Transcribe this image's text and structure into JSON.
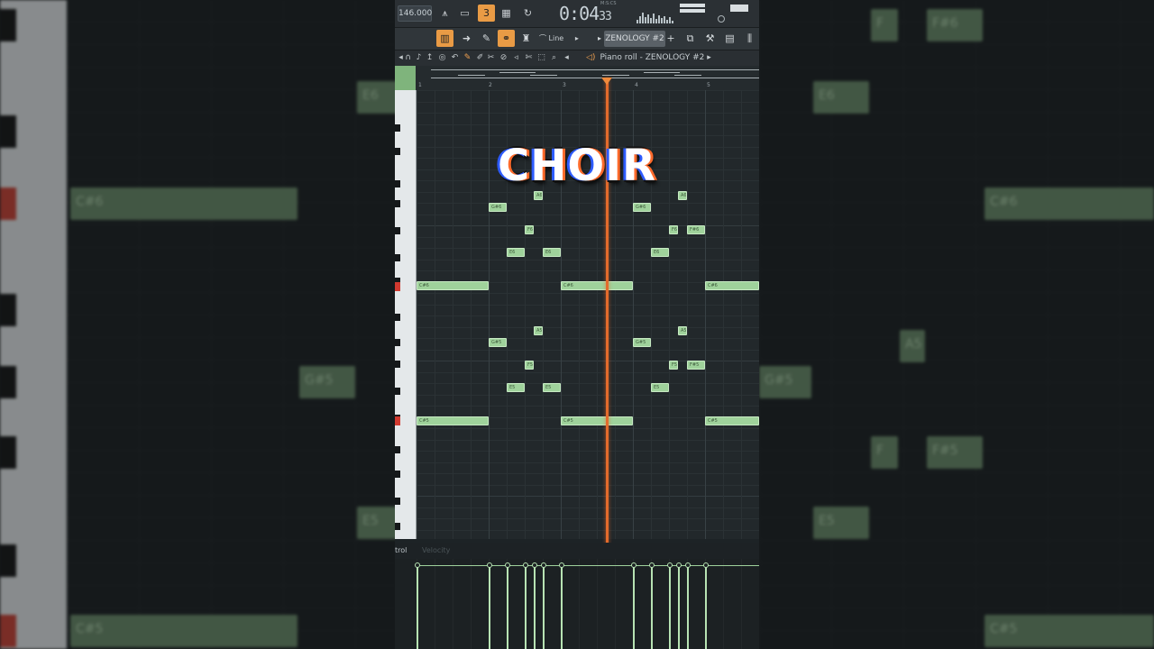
{
  "toolbar": {
    "tempo": "146.000",
    "time_main": "0:04",
    "time_sub": "33",
    "time_unit": "M:S:CS",
    "snap_label": "Line",
    "pattern_name": "ZENOLOGY #2"
  },
  "piano_roll": {
    "title": "Piano roll - ZENOLOGY #2",
    "bar_numbers": [
      "1",
      "2",
      "3",
      "4",
      "5"
    ],
    "notes": [
      {
        "label": "C#6"
      },
      {
        "label": "C#6"
      },
      {
        "label": "C#6"
      },
      {
        "label": "G#6"
      },
      {
        "label": "A6"
      },
      {
        "label": "F6"
      },
      {
        "label": "E6"
      },
      {
        "label": "E6"
      },
      {
        "label": "G#6"
      },
      {
        "label": "A6"
      },
      {
        "label": "F6"
      },
      {
        "label": "F#6"
      },
      {
        "label": "E6"
      },
      {
        "label": "C#5"
      },
      {
        "label": "C#5"
      },
      {
        "label": "C#5"
      },
      {
        "label": "G#5"
      },
      {
        "label": "A5"
      },
      {
        "label": "F5"
      },
      {
        "label": "E5"
      },
      {
        "label": "E5"
      },
      {
        "label": "G#5"
      },
      {
        "label": "A5"
      },
      {
        "label": "F5"
      },
      {
        "label": "F#5"
      },
      {
        "label": "E5"
      }
    ]
  },
  "control": {
    "label": "trol",
    "velocity_label": "Velocity"
  },
  "background": {
    "left_notes": [
      "E6",
      "C#6",
      "G#5",
      "E5",
      "C#5"
    ],
    "right_notes": [
      "F",
      "F#6",
      "E6",
      "C#6",
      "A5",
      "G#5",
      "F",
      "F#5",
      "E5",
      "C#5"
    ]
  },
  "overlay": {
    "caption": "CHOIR"
  },
  "colors": {
    "note": "#9fd29b",
    "playhead": "#e36b2c",
    "accent": "#e99b45"
  }
}
